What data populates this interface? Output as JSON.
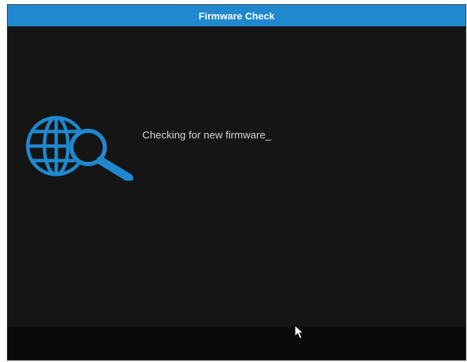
{
  "dialog": {
    "title": "Firmware Check",
    "status_message": "Checking for new firmware_"
  },
  "icons": {
    "main": "globe-search-icon",
    "pointer": "mouse-cursor-icon"
  },
  "colors": {
    "title_bar": "#1f88cf",
    "icon": "#1f88cf",
    "background": "#151515",
    "footer": "#0a0a0a",
    "text": "#d4d4d4"
  }
}
